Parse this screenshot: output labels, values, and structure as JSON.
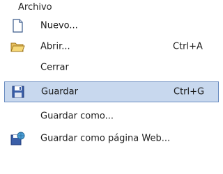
{
  "menu": {
    "title": "Archivo",
    "items": [
      {
        "label": "Nuevo...",
        "shortcut": "",
        "icon": "new-document-icon"
      },
      {
        "label": "Abrir...",
        "shortcut": "Ctrl+A",
        "icon": "open-folder-icon"
      },
      {
        "label": "Cerrar",
        "shortcut": "",
        "icon": ""
      },
      {
        "label": "Guardar",
        "shortcut": "Ctrl+G",
        "icon": "save-disk-icon",
        "highlighted": true
      },
      {
        "label": "Guardar como...",
        "shortcut": "",
        "icon": ""
      },
      {
        "label": "Guardar como página Web...",
        "shortcut": "",
        "icon": "save-as-web-icon"
      }
    ]
  },
  "colors": {
    "highlight_bg": "#c8d8ee",
    "highlight_border": "#6a8cc0"
  }
}
